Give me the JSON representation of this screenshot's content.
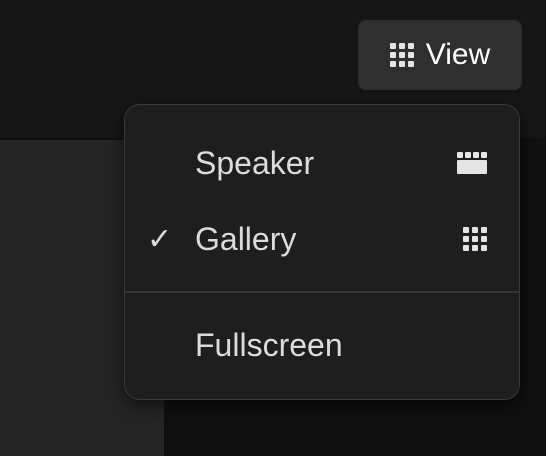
{
  "header": {
    "view_button": {
      "label": "View",
      "icon": "grid-icon"
    }
  },
  "view_menu": {
    "items": [
      {
        "label": "Speaker",
        "icon": "speaker-view-icon",
        "checked": false
      },
      {
        "label": "Gallery",
        "icon": "gallery-view-icon",
        "checked": true,
        "check_mark": "✓"
      },
      {
        "label": "Fullscreen",
        "checked": false
      }
    ]
  },
  "colors": {
    "background": "#101010",
    "menu_background": "#1e1e1e",
    "button_background": "#2f2f2f",
    "text": "#dcdcdc"
  }
}
